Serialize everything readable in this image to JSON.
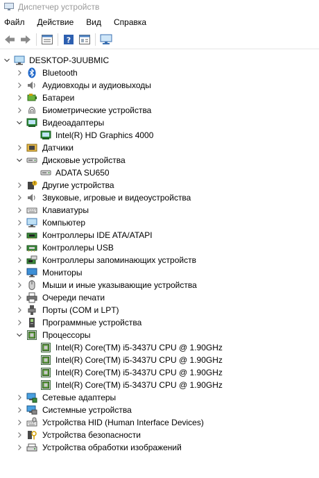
{
  "window": {
    "title": "Диспетчер устройств",
    "app_icon": "device-manager-icon"
  },
  "menu": {
    "file": "Файл",
    "action": "Действие",
    "view": "Вид",
    "help": "Справка"
  },
  "toolbar": [
    "back-icon",
    "forward-icon",
    "properties-icon",
    "help-icon",
    "view-icon",
    "monitor-icon"
  ],
  "tree": {
    "root": "DESKTOP-3UUBMIC",
    "categories": [
      {
        "label": "Bluetooth",
        "icon": "bluetooth-icon",
        "expanded": false
      },
      {
        "label": "Аудиовходы и аудиовыходы",
        "icon": "speaker-icon",
        "expanded": false
      },
      {
        "label": "Батареи",
        "icon": "battery-icon",
        "expanded": false
      },
      {
        "label": "Биометрические устройства",
        "icon": "fingerprint-icon",
        "expanded": false
      },
      {
        "label": "Видеоадаптеры",
        "icon": "display-adapter-icon",
        "expanded": true,
        "children": [
          {
            "label": "Intel(R) HD Graphics 4000",
            "icon": "display-adapter-icon"
          }
        ]
      },
      {
        "label": "Датчики",
        "icon": "sensor-icon",
        "expanded": false
      },
      {
        "label": "Дисковые устройства",
        "icon": "disk-drive-icon",
        "expanded": true,
        "children": [
          {
            "label": "ADATA SU650",
            "icon": "disk-drive-icon"
          }
        ]
      },
      {
        "label": "Другие устройства",
        "icon": "unknown-device-icon",
        "expanded": false
      },
      {
        "label": "Звуковые, игровые и видеоустройства",
        "icon": "speaker-icon",
        "expanded": false
      },
      {
        "label": "Клавиатуры",
        "icon": "keyboard-icon",
        "expanded": false
      },
      {
        "label": "Компьютер",
        "icon": "computer-icon",
        "expanded": false
      },
      {
        "label": "Контроллеры IDE ATA/ATAPI",
        "icon": "ide-controller-icon",
        "expanded": false
      },
      {
        "label": "Контроллеры USB",
        "icon": "usb-icon",
        "expanded": false
      },
      {
        "label": "Контроллеры запоминающих устройств",
        "icon": "storage-controller-icon",
        "expanded": false
      },
      {
        "label": "Мониторы",
        "icon": "monitor-icon",
        "expanded": false
      },
      {
        "label": "Мыши и иные указывающие устройства",
        "icon": "mouse-icon",
        "expanded": false
      },
      {
        "label": "Очереди печати",
        "icon": "printer-icon",
        "expanded": false
      },
      {
        "label": "Порты (COM и LPT)",
        "icon": "port-icon",
        "expanded": false
      },
      {
        "label": "Программные устройства",
        "icon": "software-device-icon",
        "expanded": false
      },
      {
        "label": "Процессоры",
        "icon": "processor-icon",
        "expanded": true,
        "children": [
          {
            "label": "Intel(R) Core(TM) i5-3437U CPU @ 1.90GHz",
            "icon": "processor-icon"
          },
          {
            "label": "Intel(R) Core(TM) i5-3437U CPU @ 1.90GHz",
            "icon": "processor-icon"
          },
          {
            "label": "Intel(R) Core(TM) i5-3437U CPU @ 1.90GHz",
            "icon": "processor-icon"
          },
          {
            "label": "Intel(R) Core(TM) i5-3437U CPU @ 1.90GHz",
            "icon": "processor-icon"
          }
        ]
      },
      {
        "label": "Сетевые адаптеры",
        "icon": "network-adapter-icon",
        "expanded": false
      },
      {
        "label": "Системные устройства",
        "icon": "system-device-icon",
        "expanded": false
      },
      {
        "label": "Устройства HID (Human Interface Devices)",
        "icon": "hid-icon",
        "expanded": false
      },
      {
        "label": "Устройства безопасности",
        "icon": "security-device-icon",
        "expanded": false
      },
      {
        "label": "Устройства обработки изображений",
        "icon": "imaging-device-icon",
        "expanded": false
      }
    ]
  }
}
